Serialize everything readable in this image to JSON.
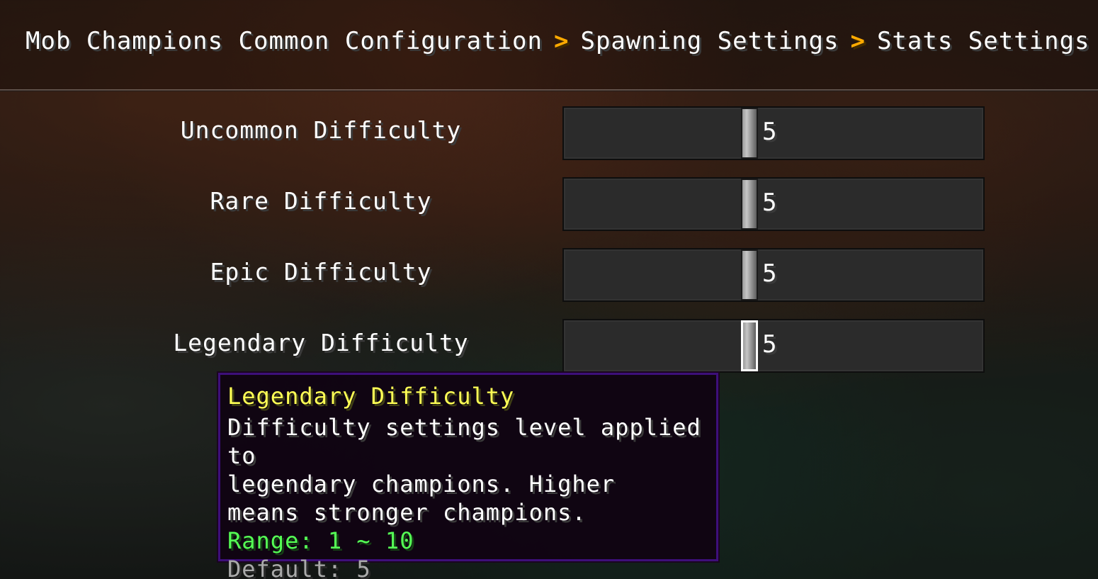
{
  "breadcrumb": {
    "items": [
      "Mob Champions Common Configuration",
      "Spawning Settings",
      "Stats Settings"
    ],
    "separator": ">"
  },
  "settings": [
    {
      "label": "Uncommon Difficulty",
      "value": "5",
      "fraction": 0.44
    },
    {
      "label": "Rare Difficulty",
      "value": "5",
      "fraction": 0.44
    },
    {
      "label": "Epic Difficulty",
      "value": "5",
      "fraction": 0.44
    },
    {
      "label": "Legendary Difficulty",
      "value": "5",
      "fraction": 0.44
    }
  ],
  "tooltip": {
    "title": "Legendary Difficulty",
    "description": "Difficulty settings level applied to\nlegendary champions. Higher\nmeans stronger champions.",
    "range": "Range: 1 ~ 10",
    "default": "Default: 5"
  },
  "colors": {
    "separator": "#ffaa00",
    "tooltip_title": "#ffff55",
    "range": "#55ff55",
    "default": "#aaaaaa",
    "tooltip_border": "#3d0f7a"
  }
}
